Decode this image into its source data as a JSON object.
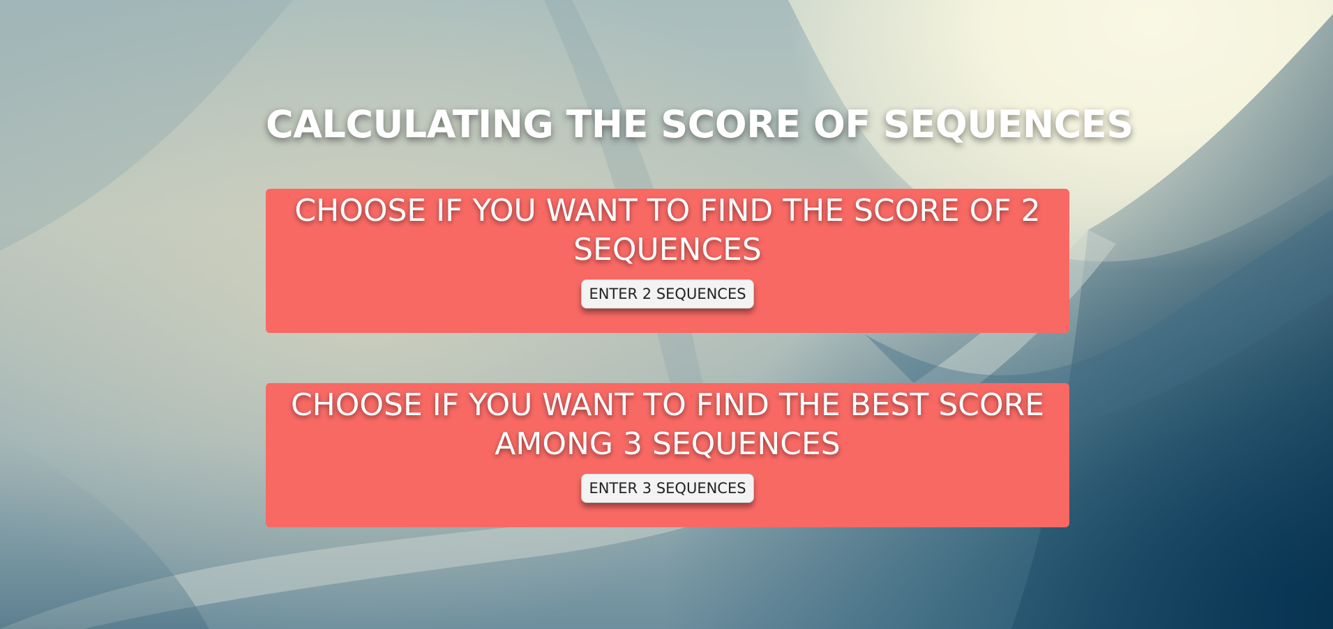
{
  "page": {
    "title": "CALCULATING THE SCORE OF SEQUENCES"
  },
  "cards": [
    {
      "heading_line1": "CHOOSE IF YOU WANT TO FIND THE SCORE OF 2",
      "heading_line2": "SEQUENCES",
      "button_label": "ENTER 2 SEQUENCES"
    },
    {
      "heading_line1": "CHOOSE IF YOU WANT TO FIND THE BEST SCORE",
      "heading_line2": "AMONG 3 SEQUENCES",
      "button_label": "ENTER 3 SEQUENCES"
    }
  ],
  "colors": {
    "card_background": "#f86964",
    "title_text": "#ffffff",
    "button_background": "#f3f3f3"
  }
}
